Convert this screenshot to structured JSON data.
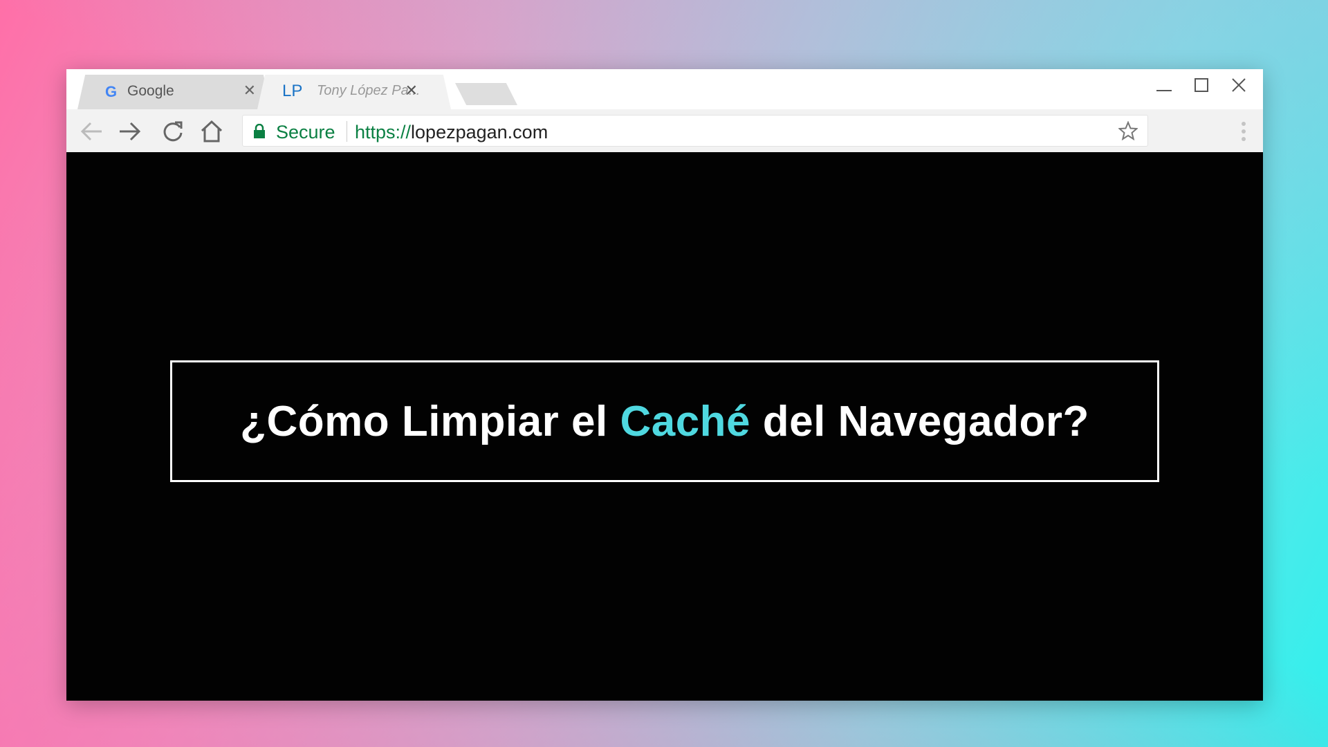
{
  "browser": {
    "tabs": [
      {
        "favicon": "G",
        "label": "Google",
        "close": "✕"
      },
      {
        "favicon": "LP",
        "label": "Tony López Pa...",
        "close": "✕"
      }
    ],
    "toolbar": {
      "secure_label": "Secure",
      "url_scheme": "https://",
      "url_host": "lopezpagan.com"
    }
  },
  "content": {
    "headline_before": "¿Cómo Limpiar el ",
    "headline_accent": "Caché",
    "headline_after": " del Navegador?"
  },
  "colors": {
    "accent": "#4fd8e0",
    "secure_green": "#0b8043",
    "lp_favicon": "#1a73c6"
  },
  "icons": [
    "google-favicon",
    "lp-favicon",
    "close-icon",
    "back-icon",
    "forward-icon",
    "reload-icon",
    "home-icon",
    "lock-icon",
    "star-icon",
    "menu-icon",
    "minimize-icon",
    "maximize-icon",
    "window-close-icon"
  ]
}
